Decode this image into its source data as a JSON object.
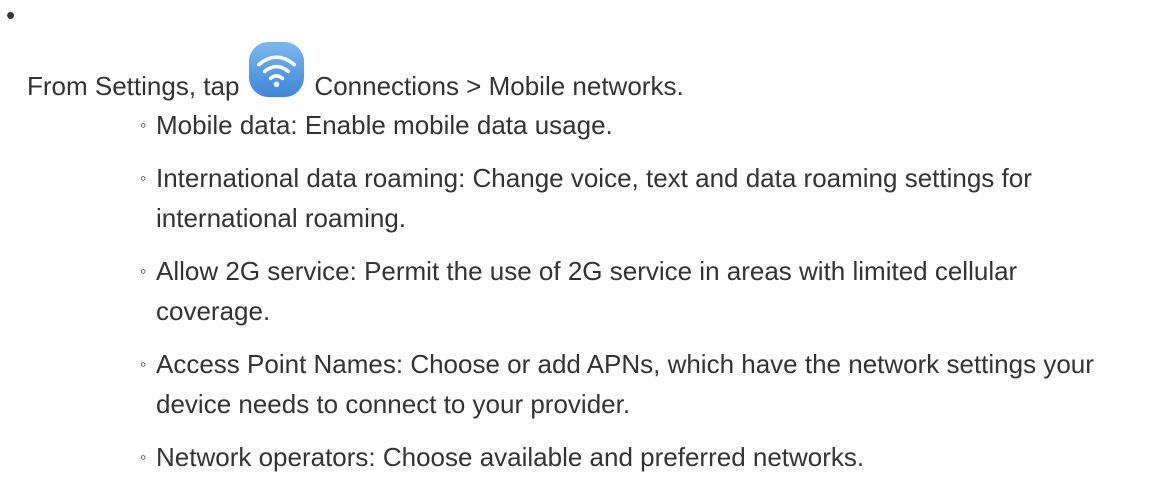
{
  "step": {
    "intro_before": "From Settings, tap",
    "icon": "connections-wifi-icon",
    "intro_after": "Connections > Mobile networks."
  },
  "options": [
    {
      "text": "Mobile data: Enable mobile data usage."
    },
    {
      "text": "International data roaming: Change voice, text and data roaming settings for international roaming."
    },
    {
      "text": "Allow 2G service: Permit the use of 2G service in areas with limited cellular coverage."
    },
    {
      "text": "Access Point Names: Choose or add APNs, which have the network settings your device needs to connect to your provider."
    },
    {
      "text": "Network operators: Choose available and preferred networks."
    }
  ],
  "colors": {
    "text": "#333333",
    "icon_gradient_top": "#7ab8f0",
    "icon_gradient_bottom": "#3f86d6"
  }
}
